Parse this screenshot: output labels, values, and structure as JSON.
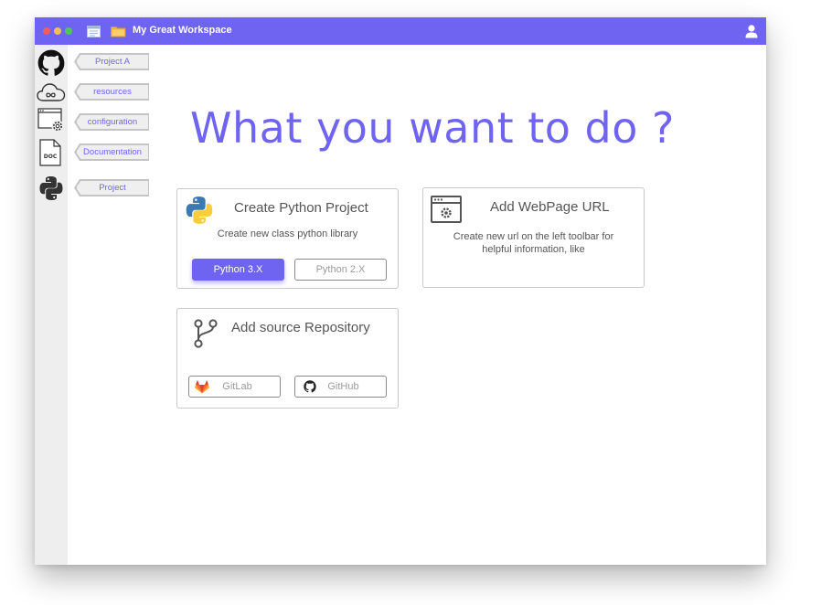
{
  "window": {
    "title": "My Great Workspace",
    "traffic_lights": {
      "close": "#f25d57",
      "minimize": "#f6be4f",
      "maximize": "#4ec65a"
    },
    "accent": "#6f64f2"
  },
  "sidebar": {
    "items": [
      {
        "icon": "github-icon",
        "label": "Project A"
      },
      {
        "icon": "cloud-icon",
        "label": "resources"
      },
      {
        "icon": "window-settings-icon",
        "label": "configuration"
      },
      {
        "icon": "doc-file-icon",
        "label": "Documentation"
      },
      {
        "icon": "python-icon",
        "label": "Project"
      }
    ]
  },
  "main": {
    "headline": "What you want to do ?",
    "cards": {
      "python": {
        "title": "Create Python Project",
        "description": "Create new class python library",
        "buttons": {
          "py3": "Python 3.X",
          "py2": "Python 2.X"
        }
      },
      "webpage": {
        "title": "Add WebPage URL",
        "description": "Create new url on the left toolbar for helpful information, like"
      },
      "repo": {
        "title": "Add source Repository",
        "buttons": {
          "gitlab": "GitLab",
          "github": "GitHub"
        }
      }
    }
  }
}
